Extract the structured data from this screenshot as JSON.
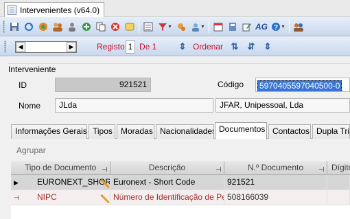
{
  "window": {
    "title": "Intervenientes (v64.0)"
  },
  "toolbar": {
    "icons": [
      "save-icon",
      "refresh-icon",
      "globe-icon",
      "users-icon",
      "user-gray-icon",
      "add-icon",
      "copy-icon",
      "delete-icon",
      "note-icon",
      "export-icon",
      "filter-icon",
      "search-people-icon",
      "calendar-icon",
      "calculator-icon",
      "edit-icon",
      "ag-icon",
      "help-icon",
      "user-group-icon"
    ],
    "ag_label": "AG"
  },
  "navigator": {
    "registo_label": "Registo",
    "registo_value": "1",
    "de_label": "De 1",
    "ordenar_label": "Ordenar"
  },
  "interveniente": {
    "section_title": "Interveniente",
    "id_label": "ID",
    "id_value": "921521",
    "codigo_label": "Código",
    "codigo_value": "5970405597040500-0",
    "nome_label": "Nome",
    "nome_value": "JLda",
    "nome_fiscal_value": "JFAR, Unipessoal, Lda"
  },
  "tabs": [
    "Informações Gerais",
    "Tipos",
    "Moradas",
    "Nacionalidades",
    "Documentos",
    "Contactos",
    "Dupla Trib"
  ],
  "active_tab": "Documentos",
  "grid": {
    "group_label": "Agrupar",
    "columns": [
      "Tipo de Documento",
      "Descrição",
      "N.º Documento",
      "Dígito"
    ],
    "rows": [
      {
        "tipo": "EURONEXT_SHOR",
        "descricao": "Euronext - Short Code",
        "numero": "921521",
        "digito": ""
      },
      {
        "tipo": "NIPC",
        "descricao": "Número de Identificação de Pes",
        "numero": "508166039",
        "digito": ""
      }
    ]
  }
}
